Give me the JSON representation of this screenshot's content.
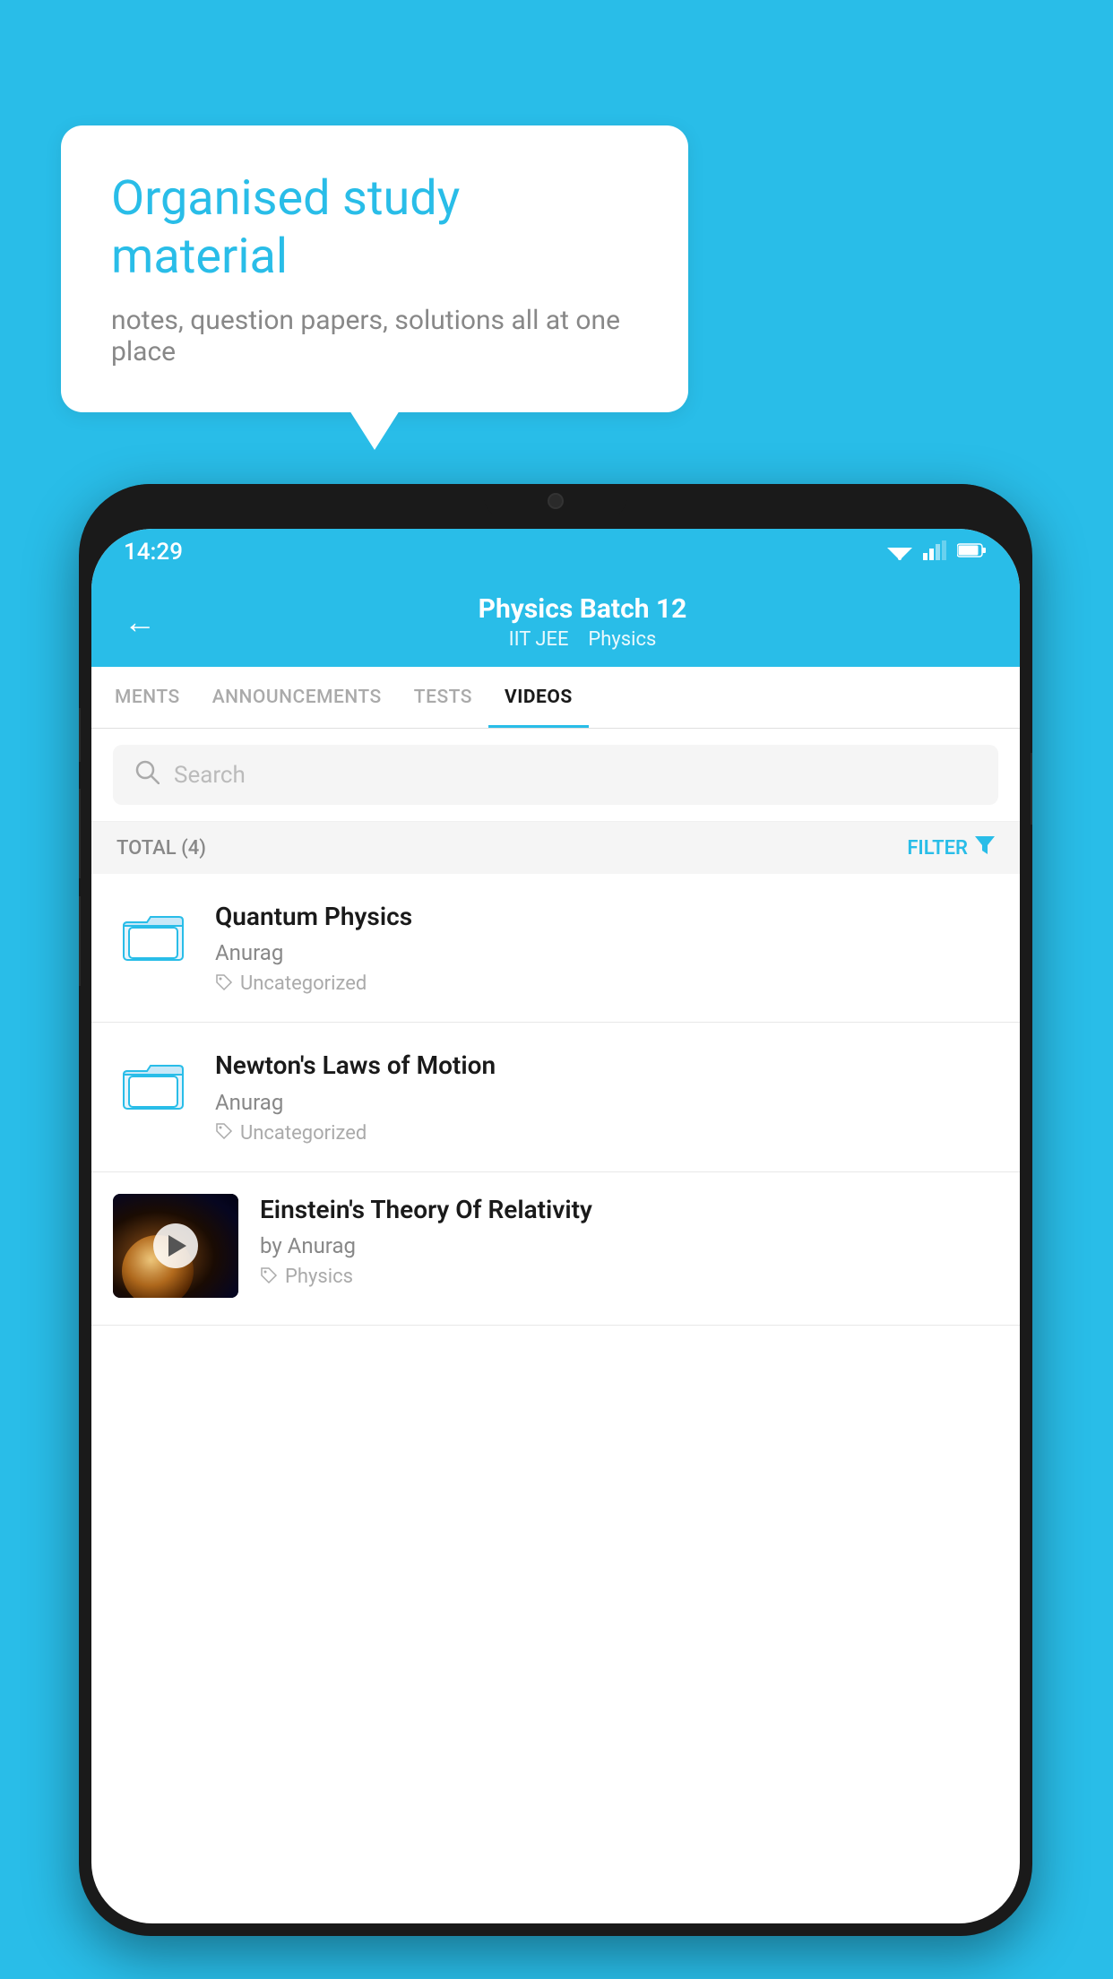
{
  "background_color": "#29bde8",
  "bubble": {
    "title": "Organised study material",
    "subtitle": "notes, question papers, solutions all at one place"
  },
  "status_bar": {
    "time": "14:29",
    "wifi": "▼",
    "signal": "◀",
    "battery": "▮"
  },
  "header": {
    "back_label": "←",
    "title": "Physics Batch 12",
    "subtitle_iit": "IIT JEE",
    "subtitle_physics": "Physics"
  },
  "tabs": [
    {
      "label": "MENTS",
      "active": false
    },
    {
      "label": "ANNOUNCEMENTS",
      "active": false
    },
    {
      "label": "TESTS",
      "active": false
    },
    {
      "label": "VIDEOS",
      "active": true
    }
  ],
  "search": {
    "placeholder": "Search"
  },
  "filter_bar": {
    "total_label": "TOTAL (4)",
    "filter_label": "FILTER"
  },
  "videos": [
    {
      "id": 1,
      "title": "Quantum Physics",
      "author": "Anurag",
      "tag": "Uncategorized",
      "has_thumb": false
    },
    {
      "id": 2,
      "title": "Newton's Laws of Motion",
      "author": "Anurag",
      "tag": "Uncategorized",
      "has_thumb": false
    },
    {
      "id": 3,
      "title": "Einstein's Theory Of Relativity",
      "author": "by Anurag",
      "tag": "Physics",
      "has_thumb": true
    }
  ]
}
